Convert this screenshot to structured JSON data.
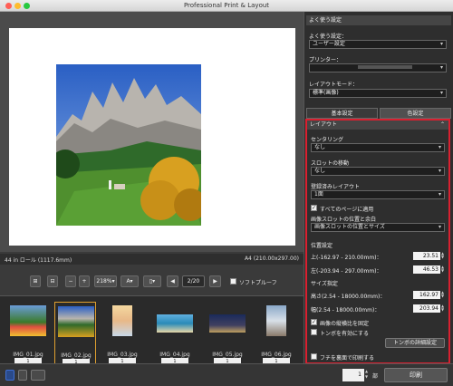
{
  "window": {
    "title": "Professional Print & Layout"
  },
  "preview": {
    "paper_info": "44 in ロール (1117.6mm)",
    "size_info": "A4 (210.00x297.00)"
  },
  "toolbar": {
    "zoom": "218%",
    "page": "2/20",
    "soft_proof": "ソフトプルーフ"
  },
  "thumbnails": [
    {
      "name": "IMG_01.jpg",
      "count": "1"
    },
    {
      "name": "IMG_02.jpg",
      "count": "1"
    },
    {
      "name": "IMG_03.jpg",
      "count": "1"
    },
    {
      "name": "IMG_04.jpg",
      "count": "1"
    },
    {
      "name": "IMG_05.jpg",
      "count": "1"
    },
    {
      "name": "IMG_06.jpg",
      "count": "1"
    }
  ],
  "sidebar": {
    "favorites_header": "よく使う設定",
    "favorites_label": "よく使う設定：",
    "favorites_value": "ユーザー設定",
    "printer_label": "プリンター：",
    "layout_mode_label": "レイアウトモード：",
    "layout_mode_value": "標準(画像)",
    "tab_basic": "基本設定",
    "tab_color": "色設定"
  },
  "layout_panel": {
    "header": "レイアウト",
    "centering_label": "センタリング",
    "centering_value": "なし",
    "slot_move_label": "スロットの移動",
    "slot_move_value": "なし",
    "registered_label": "登録済みレイアウト",
    "registered_value": "1面",
    "apply_all": "すべてのページに適用",
    "slot_pos_label": "画像スロットの位置と余白",
    "slot_pos_value": "画像スロットの位置とサイズ",
    "position_label": "位置設定",
    "top_label": "上(-162.97 - 210.00mm)：",
    "top_value": "23.51",
    "left_label": "左(-203.94 - 297.00mm)：",
    "left_value": "46.53",
    "size_label": "サイズ指定",
    "height_label": "高さ(2.54 - 18000.00mm)：",
    "height_value": "162.97",
    "width_label": "幅(2.54 - 18000.00mm)：",
    "width_value": "203.94",
    "fix_aspect": "画像の縦横比を固定",
    "crop_marks": "トンボを有効にする",
    "crop_detail": "トンボの詳細設定",
    "border": "フチを裏面で印刷する"
  },
  "footer": {
    "copies": "1",
    "copies_unit": "部",
    "print_button": "印刷"
  },
  "colors": {
    "highlight": "#d92030",
    "accent": "#3d6fd6"
  }
}
